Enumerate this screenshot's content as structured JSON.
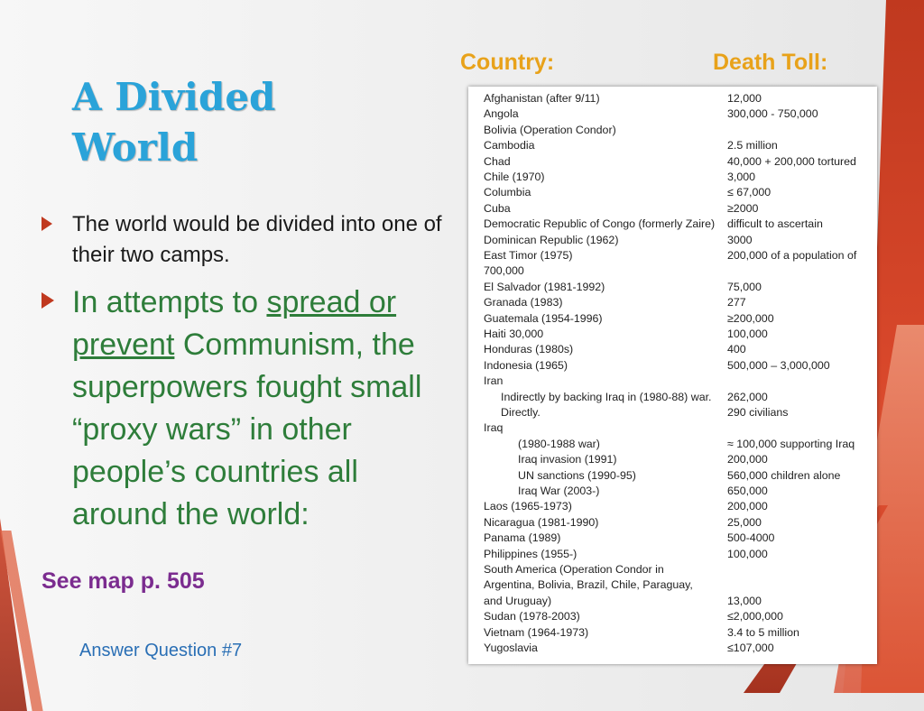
{
  "slide": {
    "title_line1": "A Divided",
    "title_line2": "World",
    "bullet1": "The world would be divided into one of their two camps.",
    "bullet2": {
      "pre": "In attempts to ",
      "u1": "spread or",
      "sp": " ",
      "u2": "prevent",
      "post": " Communism, the superpowers fought small “proxy wars” in other people’s countries all around the world:"
    },
    "see_map": "See map p. 505",
    "answer": "Answer Question #7",
    "header_country": "Country:",
    "header_toll": "Death Toll:"
  },
  "table": {
    "rows": [
      {
        "country": "Afghanistan (after 9/11)",
        "toll": "12,000",
        "indent": 0
      },
      {
        "country": "Angola",
        "toll": "300,000 - 750,000",
        "indent": 0
      },
      {
        "country": "Bolivia (Operation Condor)",
        "toll": "",
        "indent": 0
      },
      {
        "country": "Cambodia",
        "toll": "2.5 million",
        "indent": 0
      },
      {
        "country": "Chad",
        "toll": "40,000 + 200,000 tortured",
        "indent": 0
      },
      {
        "country": "Chile (1970)",
        "toll": "3,000",
        "indent": 0
      },
      {
        "country": "Columbia",
        "toll": "≤ 67,000",
        "indent": 0
      },
      {
        "country": "Cuba",
        "toll": "≥2000",
        "indent": 0
      },
      {
        "country": "Democratic Republic of Congo (formerly Zaire)",
        "toll": "difficult to ascertain",
        "indent": 0
      },
      {
        "country": "Dominican Republic  (1962)",
        "toll": "3000",
        "indent": 0
      },
      {
        "country": "East Timor  (1975)",
        "toll": "200,000 of a population of",
        "indent": 0
      },
      {
        "country": "700,000",
        "toll": "",
        "indent": 0
      },
      {
        "country": "El Salvador (1981-1992)",
        "toll": "75,000",
        "indent": 0
      },
      {
        "country": "Granada  (1983)",
        "toll": "277",
        "indent": 0
      },
      {
        "country": "Guatemala  (1954-1996)",
        "toll": "≥200,000",
        "indent": 0
      },
      {
        "country": "Haiti 30,000",
        "toll": "100,000",
        "indent": 0
      },
      {
        "country": "Honduras  (1980s)",
        "toll": "400",
        "indent": 0
      },
      {
        "country": "Indonesia (1965)",
        "toll": "500,000 – 3,000,000",
        "indent": 0
      },
      {
        "country": "Iran",
        "toll": "",
        "indent": 0
      },
      {
        "country": "Indirectly by backing Iraq in (1980-88) war.",
        "toll": "262,000",
        "indent": 1
      },
      {
        "country": "Directly.",
        "toll": "290 civilians",
        "indent": 1
      },
      {
        "country": "Iraq",
        "toll": "",
        "indent": 0
      },
      {
        "country": "(1980-1988 war)",
        "toll": "≈ 100,000 supporting Iraq",
        "indent": 2
      },
      {
        "country": "Iraq invasion (1991)",
        "toll": "200,000",
        "indent": 2
      },
      {
        "country": "UN sanctions (1990-95)",
        "toll": "560,000 children alone",
        "indent": 2
      },
      {
        "country": "Iraq War (2003-)",
        "toll": "650,000",
        "indent": 2
      },
      {
        "country": "Laos  (1965-1973)",
        "toll": "200,000",
        "indent": 0
      },
      {
        "country": "Nicaragua  (1981-1990)",
        "toll": "25,000",
        "indent": 0
      },
      {
        "country": "Panama  (1989)",
        "toll": "500-4000",
        "indent": 0
      },
      {
        "country": "Philippines (1955-)",
        "toll": "100,000",
        "indent": 0
      },
      {
        "country": "South America   (Operation Condor in",
        "toll": "",
        "indent": 0
      },
      {
        "country": "Argentina, Bolivia, Brazil, Chile, Paraguay,",
        "toll": "",
        "indent": 0
      },
      {
        "country": "and Uruguay)",
        "toll": "13,000",
        "indent": 0
      },
      {
        "country": "Sudan  (1978-2003)",
        "toll": "≤2,000,000",
        "indent": 0
      },
      {
        "country": "Vietnam  (1964-1973)",
        "toll": " 3.4 to 5 million",
        "indent": 0
      },
      {
        "country": "Yugoslavia",
        "toll": "≤107,000",
        "indent": 0
      }
    ]
  }
}
